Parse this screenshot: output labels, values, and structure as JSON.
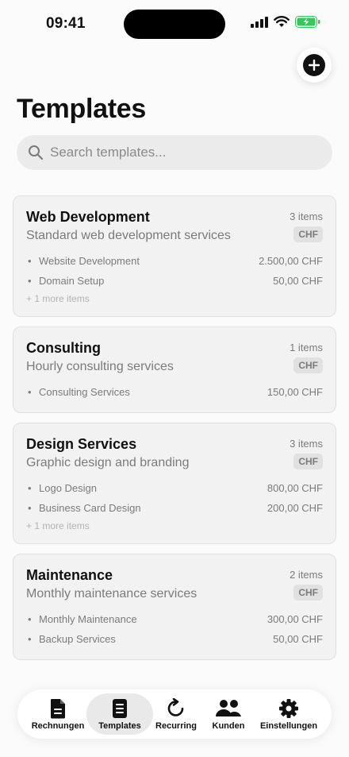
{
  "status": {
    "time": "09:41"
  },
  "header": {
    "title": "Templates",
    "add_icon": "plus-circle-icon"
  },
  "search": {
    "placeholder": "Search templates...",
    "icon": "search-icon"
  },
  "templates": [
    {
      "title": "Web Development",
      "description": "Standard web development services",
      "count": "3 items",
      "currency": "CHF",
      "items": [
        {
          "name": "Website Development",
          "price": "2.500,00 CHF"
        },
        {
          "name": "Domain Setup",
          "price": "50,00 CHF"
        }
      ],
      "more": "+ 1 more items"
    },
    {
      "title": "Consulting",
      "description": "Hourly consulting services",
      "count": "1 items",
      "currency": "CHF",
      "items": [
        {
          "name": "Consulting Services",
          "price": "150,00 CHF"
        }
      ]
    },
    {
      "title": "Design Services",
      "description": "Graphic design and branding",
      "count": "3 items",
      "currency": "CHF",
      "items": [
        {
          "name": "Logo Design",
          "price": "800,00 CHF"
        },
        {
          "name": "Business Card Design",
          "price": "200,00 CHF"
        }
      ],
      "more": "+ 1 more items"
    },
    {
      "title": "Maintenance",
      "description": "Monthly maintenance services",
      "count": "2 items",
      "currency": "CHF",
      "items": [
        {
          "name": "Monthly Maintenance",
          "price": "300,00 CHF"
        },
        {
          "name": "Backup Services",
          "price": "50,00 CHF"
        }
      ]
    }
  ],
  "tabbar": {
    "active": "Templates",
    "tabs": [
      {
        "label": "Rechnungen",
        "icon": "document-icon"
      },
      {
        "label": "Templates",
        "icon": "template-icon"
      },
      {
        "label": "Recurring",
        "icon": "refresh-icon"
      },
      {
        "label": "Kunden",
        "icon": "people-icon"
      },
      {
        "label": "Einstellungen",
        "icon": "gear-icon"
      }
    ]
  },
  "colors": {
    "accent": "#111111",
    "battery": "#34c759",
    "card_bg": "#f2f2f2",
    "muted_text": "#7b7b7b"
  }
}
